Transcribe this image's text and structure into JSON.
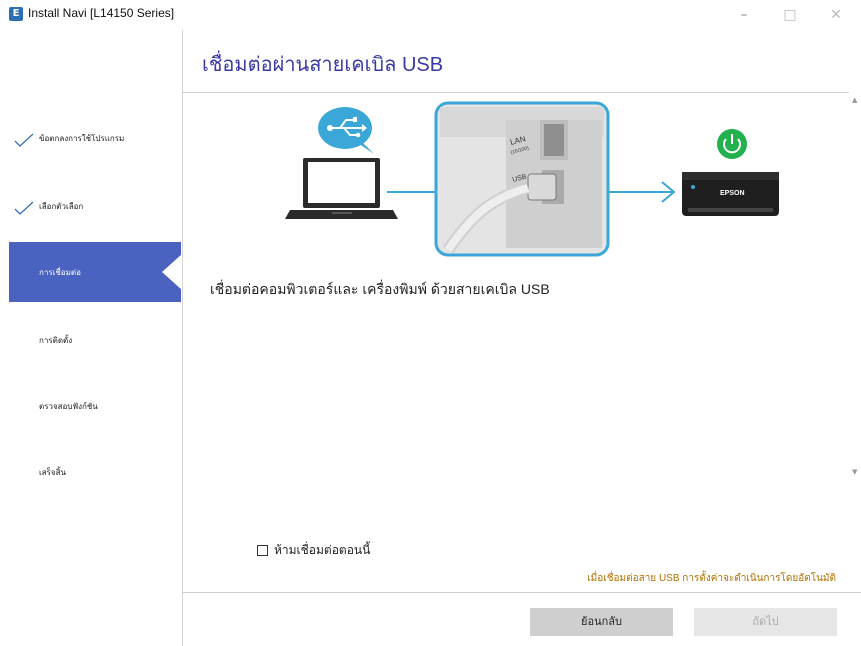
{
  "window": {
    "title": "Install Navi [L14150 Series]",
    "icon_letter": "E",
    "minimize": "–",
    "maximize": "□",
    "close": "✕"
  },
  "sidebar": {
    "items": [
      {
        "label": "ข้อตกลงการใช้โปรแกรม",
        "done": true
      },
      {
        "label": "เลือกตัวเลือก",
        "done": true
      },
      {
        "label": "การเชื่อมต่อ",
        "active": true
      },
      {
        "label": "การติดตั้ง"
      },
      {
        "label": "ตรวจสอบฟังก์ชัน"
      },
      {
        "label": "เสร็จสิ้น"
      }
    ]
  },
  "main": {
    "title": "เชื่อมต่อผ่านสายเคเบิล USB",
    "illustration": {
      "port_labels": [
        "LAN",
        "(10/100)",
        "USB"
      ],
      "printer_brand": "EPSON"
    },
    "description": "เชื่อมต่อคอมพิวเตอร์และ เครื่องพิมพ์ ด้วยสายเคเบิล USB"
  },
  "footer": {
    "checkbox_label": "ห้ามเชื่อมต่อตอนนี้",
    "note": "เมื่อเชื่อมต่อสาย USB การตั้งค่าจะดำเนินการโดยอัตโนมัติ",
    "back_label": "ย้อนกลับ",
    "next_label": "ถัดไป"
  },
  "colors": {
    "accent": "#4a63c0",
    "title": "#3a3aa6",
    "illustration_blue": "#3aa7d8",
    "power_green": "#22b14c",
    "note": "#b07000"
  }
}
